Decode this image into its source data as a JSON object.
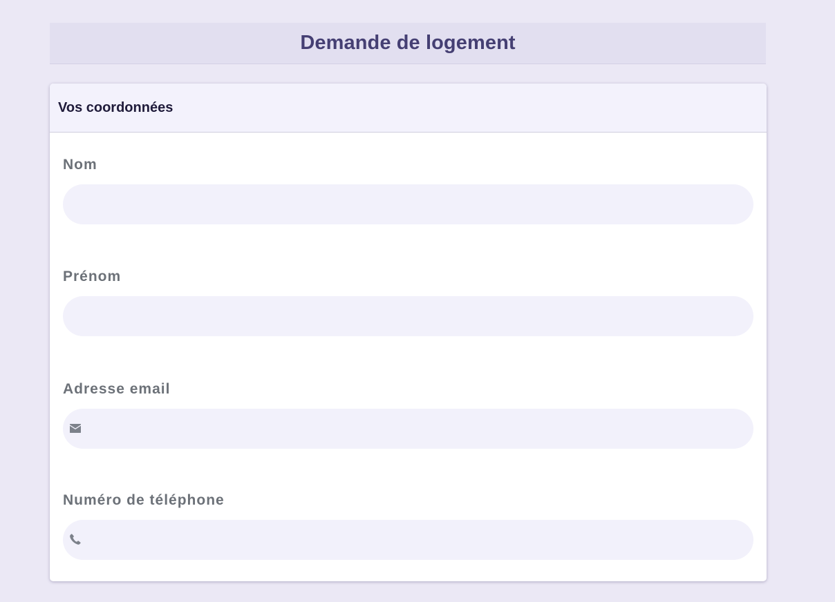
{
  "page": {
    "title": "Demande de logement"
  },
  "section": {
    "title": "Vos coordonnées"
  },
  "fields": {
    "nom": {
      "label": "Nom",
      "value": "",
      "placeholder": ""
    },
    "prenom": {
      "label": "Prénom",
      "value": "",
      "placeholder": ""
    },
    "email": {
      "label": "Adresse email",
      "value": "",
      "placeholder": "",
      "icon": "envelope-icon"
    },
    "telephone": {
      "label": "Numéro de téléphone",
      "value": "",
      "placeholder": "",
      "icon": "phone-icon"
    }
  },
  "colors": {
    "background": "#ebe8f5",
    "header_bg": "#e2dff0",
    "title": "#453f73",
    "input_bg": "#f2f1fb",
    "label": "#6c7178"
  }
}
